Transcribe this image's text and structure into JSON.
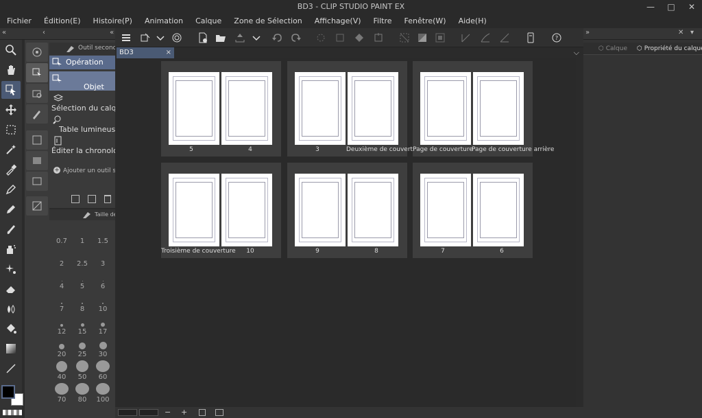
{
  "window": {
    "title": "BD3 - CLIP STUDIO PAINT EX"
  },
  "menu": [
    "Fichier",
    "Édition(E)",
    "Histoire(P)",
    "Animation",
    "Calque",
    "Zone de Sélection",
    "Affichage(V)",
    "Filtre",
    "Fenêtre(W)",
    "Aide(H)"
  ],
  "subtool_panel": {
    "header": "Outil secondaire",
    "items": [
      {
        "label": "Opération"
      },
      {
        "label": "Objet"
      },
      {
        "label": "Sélection du calque"
      },
      {
        "label": "Table lumineuse"
      },
      {
        "label": "Éditer la chronologie"
      }
    ],
    "add_label": "Ajouter un outil secondaire"
  },
  "brush_panel": {
    "header": "Taille de forme",
    "sizes": [
      "0.7",
      "1",
      "1.5",
      "2",
      "2.5",
      "3",
      "4",
      "5",
      "6",
      "7",
      "8",
      "10",
      "12",
      "15",
      "17",
      "20",
      "25",
      "30",
      "40",
      "50",
      "60",
      "70",
      "80",
      "100"
    ]
  },
  "document_tab": {
    "label": "BD3",
    "close": "×"
  },
  "right_panel": {
    "tab_layer": "Calque",
    "tab_layer_property": "Propriété du calque"
  },
  "spreads": [
    {
      "left": "5",
      "right": "4"
    },
    {
      "left": "3",
      "right": "Deuxième de couverture"
    },
    {
      "left": "Page de couverture",
      "right": "Page de couverture arrière"
    },
    {
      "left": "Troisième de couverture",
      "right": "10"
    },
    {
      "left": "9",
      "right": "8"
    },
    {
      "left": "7",
      "right": "6"
    }
  ],
  "colors": {
    "accent": "#5a6b8c",
    "main_color": "#000000",
    "sub_color": "#ffffff"
  }
}
